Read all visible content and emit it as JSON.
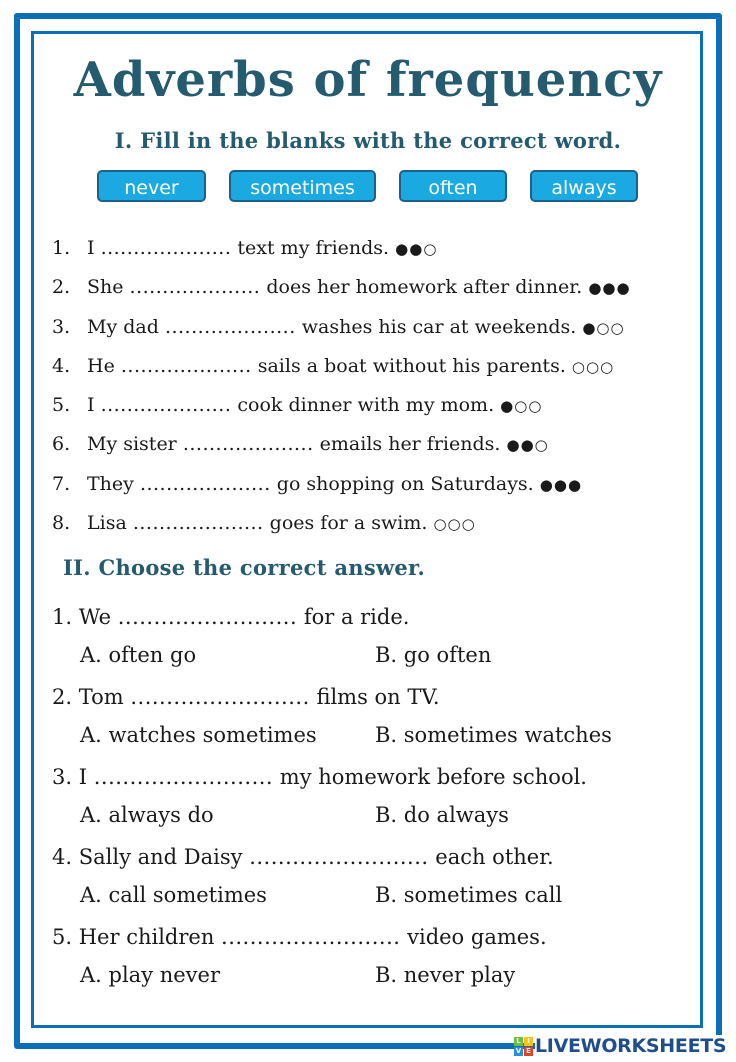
{
  "title": "Adverbs of frequency",
  "section1": {
    "heading": "I. Fill in the blanks with the correct word.",
    "word_bank": [
      "never",
      "sometimes",
      "often",
      "always"
    ],
    "items": [
      {
        "num": "1.",
        "before": "I",
        "blank": "....................",
        "after": "text my friends.",
        "dots": "●●○"
      },
      {
        "num": "2.",
        "before": "She",
        "blank": "....................",
        "after": "does her homework after dinner.",
        "dots": "●●●"
      },
      {
        "num": "3.",
        "before": "My dad",
        "blank": "....................",
        "after": "washes his car at weekends.",
        "dots": "●○○"
      },
      {
        "num": "4.",
        "before": "He",
        "blank": "....................",
        "after": "sails a boat without his parents.",
        "dots": "○○○"
      },
      {
        "num": "5.",
        "before": "I",
        "blank": "....................",
        "after": "cook dinner with my mom.",
        "dots": "●○○"
      },
      {
        "num": "6.",
        "before": "My sister",
        "blank": "....................",
        "after": "emails her friends.",
        "dots": "●●○"
      },
      {
        "num": "7.",
        "before": "They",
        "blank": "....................",
        "after": "go shopping on Saturdays.",
        "dots": "●●●"
      },
      {
        "num": "8.",
        "before": "Lisa",
        "blank": "....................",
        "after": "goes for a swim.",
        "dots": "○○○"
      }
    ]
  },
  "section2": {
    "heading": "II. Choose the correct answer.",
    "questions": [
      {
        "num": "1.",
        "before": "We",
        "blank": ".........................",
        "after": "for a ride.",
        "option_a": "A. often go",
        "option_b": "B. go often"
      },
      {
        "num": "2.",
        "before": "Tom",
        "blank": ".........................",
        "after": "films on TV.",
        "option_a": "A. watches sometimes",
        "option_b": "B. sometimes watches"
      },
      {
        "num": "3.",
        "before": "I",
        "blank": ".........................",
        "after": "my homework before school.",
        "option_a": "A. always do",
        "option_b": "B. do always"
      },
      {
        "num": "4.",
        "before": "Sally and Daisy",
        "blank": ".........................",
        "after": "each other.",
        "option_a": "A. call sometimes",
        "option_b": "B. sometimes call"
      },
      {
        "num": "5.",
        "before": "Her children",
        "blank": ".........................",
        "after": "video games.",
        "option_a": "A. play never",
        "option_b": "B. never play"
      }
    ]
  },
  "logo": {
    "tiles": [
      "L",
      "I",
      "V",
      "E"
    ],
    "text": "LIVEWORKSHEETS"
  },
  "colors": {
    "frame": "#0b6fb8",
    "heading": "#245b6e",
    "chip_fill": "#1ba9e1",
    "chip_border": "#1f5f8b",
    "logo_text": "#1f4e8c"
  }
}
